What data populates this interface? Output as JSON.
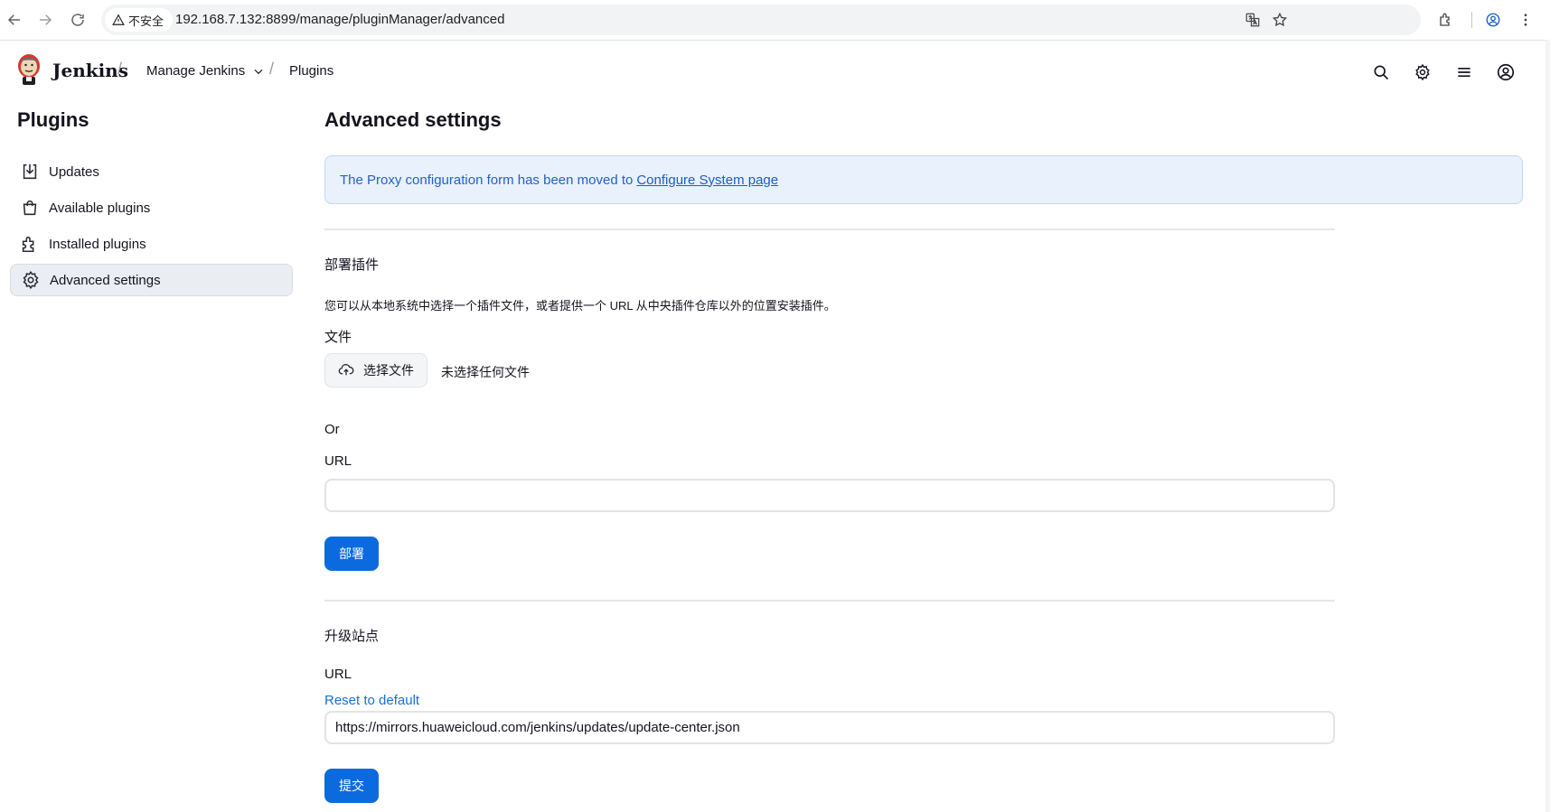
{
  "browser": {
    "security_label": "不安全",
    "url": "192.168.7.132:8899/manage/pluginManager/advanced"
  },
  "header": {
    "brand": "Jenkins",
    "breadcrumbs": [
      {
        "label": "Manage Jenkins"
      },
      {
        "label": "Plugins"
      }
    ]
  },
  "sidebar": {
    "title": "Plugins",
    "items": [
      {
        "label": "Updates"
      },
      {
        "label": "Available plugins"
      },
      {
        "label": "Installed plugins"
      },
      {
        "label": "Advanced settings"
      }
    ],
    "active_index": 3
  },
  "main": {
    "title": "Advanced settings",
    "notice": {
      "text": "The Proxy configuration form has been moved to",
      "link": "Configure System page"
    },
    "deploy": {
      "title": "部署插件",
      "description": "您可以从本地系统中选择一个插件文件，或者提供一个 URL 从中央插件仓库以外的位置安装插件。",
      "file_label": "文件",
      "choose_file": "选择文件",
      "no_file": "未选择任何文件",
      "or_label": "Or",
      "url_label": "URL",
      "url_value": "",
      "submit": "部署"
    },
    "update_site": {
      "title": "升级站点",
      "url_label": "URL",
      "reset_link": "Reset to default",
      "url_value": "https://mirrors.huaweicloud.com/jenkins/updates/update-center.json",
      "submit": "提交"
    }
  },
  "colors": {
    "primary": "#0b6bde",
    "notice_bg": "#e9f1fd",
    "link": "#1a6ed8"
  }
}
